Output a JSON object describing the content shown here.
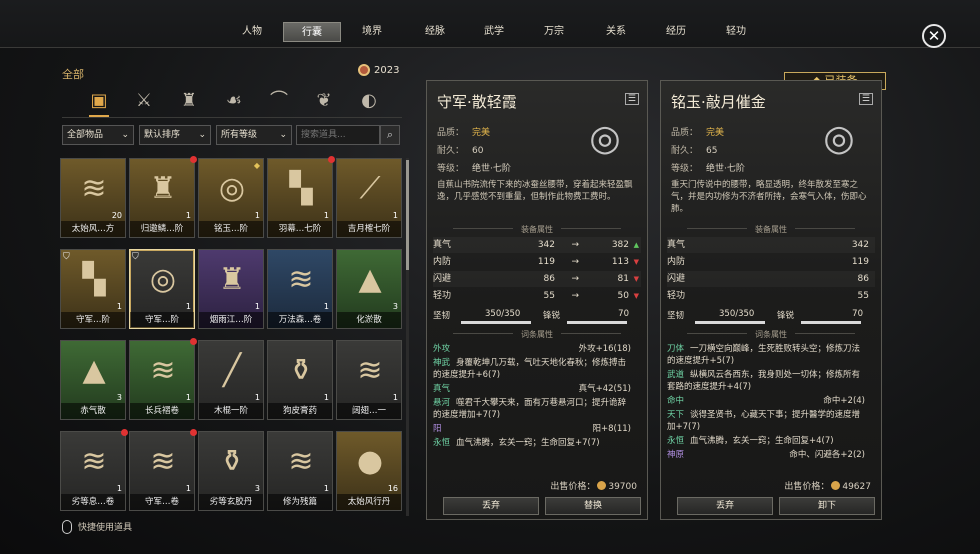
{
  "tabs": [
    "人物",
    "行囊",
    "境界",
    "经脉",
    "武学",
    "万宗",
    "关系",
    "经历",
    "轻功"
  ],
  "active_tab": "行囊",
  "left": {
    "category": "全部",
    "currency": "2023",
    "filters": {
      "item_type": "全部物品",
      "sort": "默认排序",
      "grade": "所有等级",
      "search_placeholder": "搜索道具..."
    },
    "hint": "快捷使用道具",
    "items": [
      {
        "name": "太始风…方",
        "count": "20",
        "quality": "gold",
        "icon": "scroll-icon"
      },
      {
        "name": "归遨鳞…阶",
        "count": "1",
        "quality": "gold",
        "icon": "armor-icon",
        "dot": true
      },
      {
        "name": "铭玉…阶",
        "count": "1",
        "quality": "gold",
        "icon": "belt-icon",
        "mark": "◆"
      },
      {
        "name": "羽幕…七阶",
        "count": "1",
        "quality": "gold",
        "icon": "boots-icon",
        "dot": true
      },
      {
        "name": "吉月榷七阶",
        "count": "1",
        "quality": "gold",
        "icon": "spear-icon"
      },
      {
        "name": "守军…阶",
        "count": "1",
        "quality": "gold",
        "icon": "boots-icon",
        "eq": true
      },
      {
        "name": "守军…阶",
        "count": "1",
        "quality": "gray",
        "icon": "belt-icon",
        "eq": true,
        "selected": true
      },
      {
        "name": "烟雨江…阶",
        "count": "1",
        "quality": "purple",
        "icon": "armor-icon"
      },
      {
        "name": "万法森…卷",
        "count": "1",
        "quality": "blue",
        "icon": "scroll-icon"
      },
      {
        "name": "化淤散",
        "count": "3",
        "quality": "green",
        "icon": "powder-icon"
      },
      {
        "name": "赤气散",
        "count": "3",
        "quality": "green",
        "icon": "powder-icon"
      },
      {
        "name": "长兵褶卷",
        "count": "1",
        "quality": "green",
        "icon": "scroll-icon",
        "dot": true
      },
      {
        "name": "木棍一阶",
        "count": "1",
        "quality": "gray",
        "icon": "staff-icon"
      },
      {
        "name": "狗皮膏药",
        "count": "1",
        "quality": "gray",
        "icon": "pot-icon"
      },
      {
        "name": "阔翅…一",
        "count": "1",
        "quality": "gray",
        "icon": "scroll-icon"
      },
      {
        "name": "劣等息…卷",
        "count": "1",
        "quality": "gray",
        "icon": "scroll-icon",
        "dot": true
      },
      {
        "name": "守军…卷",
        "count": "1",
        "quality": "gray",
        "icon": "scroll-icon",
        "dot": true
      },
      {
        "name": "劣等玄胶丹",
        "count": "3",
        "quality": "gray",
        "icon": "pot-icon"
      },
      {
        "name": "修为残篇",
        "count": "1",
        "quality": "gray",
        "icon": "scroll-icon"
      },
      {
        "name": "太始风行丹",
        "count": "16",
        "quality": "gold",
        "icon": "orb-icon"
      }
    ]
  },
  "labels": {
    "quality": "品质：",
    "durability": "耐久：",
    "grade": "等级：",
    "equip_attrs": "装备属性",
    "tag_attrs": "词条属性",
    "price": "出售价格：",
    "equipped": "已装备",
    "toughness": "坚韧",
    "sharp": "锋锐"
  },
  "left_panel": {
    "title": "守军·散轻霞",
    "quality": "完美",
    "durability": "60",
    "grade": "绝世·七阶",
    "desc": "自蕉山书院流传下来的冰蚕丝腰带，穿着起来轻盈飘逸，几乎感觉不到重量，但制作此物费工费时。",
    "attrs": [
      {
        "k": "真气",
        "v": "342",
        "nv": "382",
        "dir": "up"
      },
      {
        "k": "内防",
        "v": "119",
        "nv": "113",
        "dir": "down"
      },
      {
        "k": "闪避",
        "v": "86",
        "nv": "81",
        "dir": "down"
      },
      {
        "k": "轻功",
        "v": "55",
        "nv": "50",
        "dir": "down"
      }
    ],
    "toughness": "350/350",
    "sharp": "70",
    "tags": [
      {
        "k": "外攻",
        "t": "",
        "r": "外攻+16(18)"
      },
      {
        "k": "神武",
        "t": "身覆乾坤几万载，气吐天地化春秋；修炼搏击的速度提升+6(7)",
        "r": ""
      },
      {
        "k": "真气",
        "t": "",
        "r": "真气+42(51)"
      },
      {
        "k": "悬河",
        "t": "噬君千大攀天来，面有万巷悬河口；提升诡辞的速度增加+7(7)",
        "r": ""
      },
      {
        "k": "阳",
        "t": "",
        "r": "阳+8(11)"
      },
      {
        "k": "永恒",
        "t": "血气沸腾，玄关一窍；生命回复+7(7)",
        "r": ""
      }
    ],
    "price": "39700",
    "btn1": "丢弃",
    "btn2": "替换"
  },
  "right_panel": {
    "title": "铭玉·敲月催金",
    "quality": "完美",
    "durability": "65",
    "grade": "绝世·七阶",
    "desc": "重天门传说中的腰带，略显透明，终年散发至寒之气，并是内功修为不济者所持，会寒气入体，伤即心肺。",
    "attrs": [
      {
        "k": "真气",
        "v": "342"
      },
      {
        "k": "内防",
        "v": "119"
      },
      {
        "k": "闪避",
        "v": "86"
      },
      {
        "k": "轻功",
        "v": "55"
      }
    ],
    "toughness": "350/350",
    "sharp": "70",
    "tags": [
      {
        "k": "刀体",
        "t": "一刀横空向巅峰，生死胜败转头空；修炼刀法的速度提升+5(7)",
        "r": ""
      },
      {
        "k": "武道",
        "t": "纵横风云各西东，我身则处一切体；修炼所有套路的速度提升+4(7)",
        "r": ""
      },
      {
        "k": "命中",
        "t": "",
        "r": "命中+2(4)"
      },
      {
        "k": "天下",
        "t": "谈得圣贤书，心藏天下事；提升醫学的速度增加+7(7)",
        "r": ""
      },
      {
        "k": "永恒",
        "t": "血气沸腾，玄关一窍；生命回复+4(7)",
        "r": ""
      },
      {
        "k": "神原",
        "t": "",
        "r": "命中、闪避各+2(2)"
      }
    ],
    "price": "49627",
    "btn1": "丢弃",
    "btn2": "卸下"
  }
}
